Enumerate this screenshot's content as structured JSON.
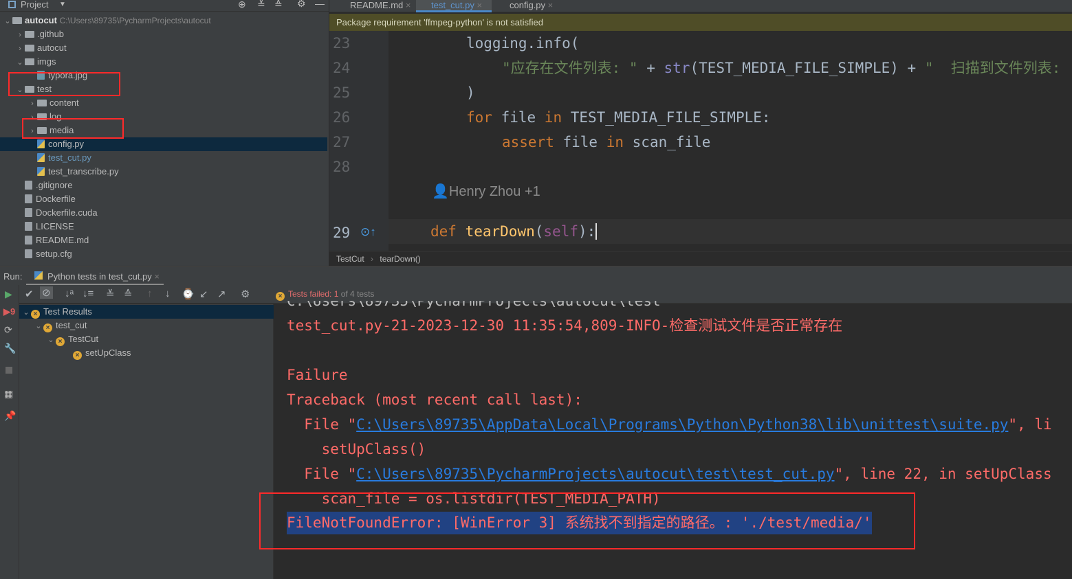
{
  "project": {
    "title": "Project",
    "root_name": "autocut",
    "root_path": "C:\\Users\\89735\\PycharmProjects\\autocut",
    "items": [
      {
        "label": ".github",
        "type": "folder",
        "depth": 1,
        "expanded": false
      },
      {
        "label": "autocut",
        "type": "folder",
        "depth": 1,
        "expanded": false
      },
      {
        "label": "imgs",
        "type": "folder",
        "depth": 1,
        "expanded": true
      },
      {
        "label": "typora.jpg",
        "type": "image",
        "depth": 2
      },
      {
        "label": "test",
        "type": "folder",
        "depth": 1,
        "expanded": true
      },
      {
        "label": "content",
        "type": "folder",
        "depth": 2,
        "expanded": false
      },
      {
        "label": "log",
        "type": "folder",
        "depth": 2,
        "expanded": false
      },
      {
        "label": "media",
        "type": "folder",
        "depth": 2,
        "expanded": false
      },
      {
        "label": "config.py",
        "type": "py",
        "depth": 2,
        "selected": true
      },
      {
        "label": "test_cut.py",
        "type": "py",
        "depth": 2,
        "modified": true
      },
      {
        "label": "test_transcribe.py",
        "type": "py",
        "depth": 2
      },
      {
        "label": ".gitignore",
        "type": "text",
        "depth": 1
      },
      {
        "label": "Dockerfile",
        "type": "text",
        "depth": 1
      },
      {
        "label": "Dockerfile.cuda",
        "type": "text",
        "depth": 1
      },
      {
        "label": "LICENSE",
        "type": "text",
        "depth": 1
      },
      {
        "label": "README.md",
        "type": "text",
        "depth": 1
      },
      {
        "label": "setup.cfg",
        "type": "text",
        "depth": 1
      }
    ]
  },
  "editor": {
    "tabs": [
      {
        "label": "README.md"
      },
      {
        "label": "test_cut.py",
        "active": true
      },
      {
        "label": "config.py"
      }
    ],
    "banner": "Package requirement 'ffmpeg-python' is not satisfied",
    "lines": [
      {
        "n": "23",
        "text": "logging.info("
      },
      {
        "n": "24",
        "text": "\"应存在文件列表: \" + str(TEST_MEDIA_FILE_SIMPLE) + \"  扫描到文件列表:"
      },
      {
        "n": "25",
        "text": ")"
      },
      {
        "n": "26",
        "text": "for file in TEST_MEDIA_FILE_SIMPLE:"
      },
      {
        "n": "27",
        "text": "assert file in scan_file"
      },
      {
        "n": "28",
        "text": ""
      },
      {
        "n": "29",
        "text": "def tearDown(self):"
      }
    ],
    "author_hint": "Henry Zhou +1",
    "breadcrumb": [
      "TestCut",
      "tearDown()"
    ]
  },
  "run": {
    "label": "Run:",
    "tab": "Python tests in test_cut.py",
    "status_failed": "Tests failed: 1",
    "status_rest": "of 4 tests",
    "tree": [
      {
        "label": "Test Results",
        "depth": 0
      },
      {
        "label": "test_cut",
        "depth": 1
      },
      {
        "label": "TestCut",
        "depth": 2
      },
      {
        "label": "setUpClass",
        "depth": 3
      }
    ],
    "console": {
      "partial": "C:\\Users\\89735\\PycharmProjects\\autocut\\test",
      "log": "test_cut.py-21-2023-12-30 11:35:54,809-INFO-检查测试文件是否正常存在",
      "failure": "Failure",
      "traceback": "Traceback (most recent call last):",
      "file1_prefix": "  File \"",
      "file1_link": "C:\\Users\\89735\\AppData\\Local\\Programs\\Python\\Python38\\lib\\unittest\\suite.py",
      "file1_suffix": "\", li",
      "call1": "    setUpClass()",
      "file2_prefix": "  File \"",
      "file2_link": "C:\\Users\\89735\\PycharmProjects\\autocut\\test\\test_cut.py",
      "file2_suffix": "\", line 22, in setUpClass",
      "call2": "    scan_file = os.listdir(TEST_MEDIA_PATH)",
      "error": "FileNotFoundError: [WinError 3] 系统找不到指定的路径。: './test/media/'"
    }
  },
  "colors": {
    "highlight_box": "#ff2a2a",
    "error_text": "#ff6b68",
    "link": "#287bde",
    "selection": "#214283"
  }
}
